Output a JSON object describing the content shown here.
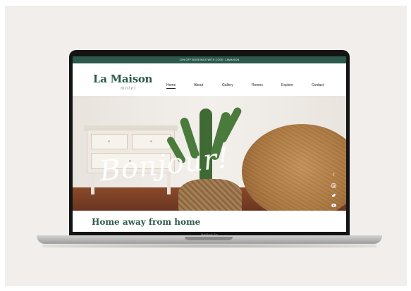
{
  "promo": {
    "text": "10% OFF BOOKINGS WITH CODE: LAMAISON"
  },
  "brand": {
    "name": "La Maison",
    "script": "motel"
  },
  "nav": {
    "items": [
      {
        "label": "Home",
        "active": true
      },
      {
        "label": "About"
      },
      {
        "label": "Gallery"
      },
      {
        "label": "Rooms"
      },
      {
        "label": "Explore"
      },
      {
        "label": "Contact"
      }
    ]
  },
  "hero": {
    "script_text": "Bonjour!"
  },
  "social": {
    "icons": [
      "facebook-icon",
      "instagram-icon",
      "twitter-icon",
      "youtube-icon"
    ]
  },
  "section": {
    "title": "Home away from home"
  },
  "device": {
    "label": "MacBook Pro"
  },
  "colors": {
    "brand_green": "#2b5a4a",
    "bezel": "#141414"
  }
}
